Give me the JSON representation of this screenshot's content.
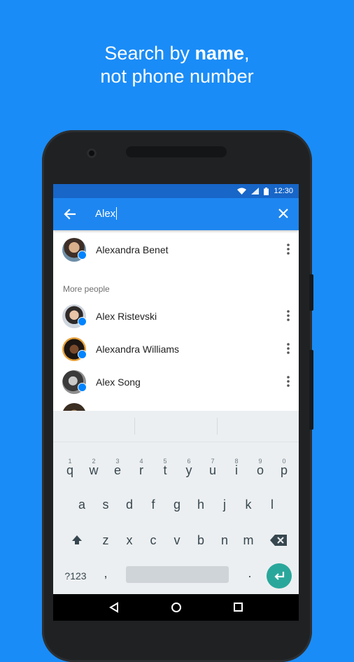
{
  "headline": {
    "line1_prefix": "Search by ",
    "line1_bold": "name",
    "line1_suffix": ",",
    "line2": "not phone number"
  },
  "status_bar": {
    "time": "12:30",
    "icons": [
      "wifi-icon",
      "signal-icon",
      "battery-icon"
    ]
  },
  "search": {
    "query": "Alex",
    "back_icon": "back-arrow-icon",
    "clear_icon": "close-icon"
  },
  "top_result": {
    "name": "Alexandra Benet"
  },
  "more_people": {
    "label": "More people",
    "items": [
      {
        "name": "Alex Ristevski"
      },
      {
        "name": "Alexandra Williams"
      },
      {
        "name": "Alex Song"
      }
    ]
  },
  "keyboard": {
    "row1": [
      "q",
      "w",
      "e",
      "r",
      "t",
      "y",
      "u",
      "i",
      "o",
      "p"
    ],
    "row1_numbers": [
      "1",
      "2",
      "3",
      "4",
      "5",
      "6",
      "7",
      "8",
      "9",
      "0"
    ],
    "row2": [
      "a",
      "s",
      "d",
      "f",
      "g",
      "h",
      "j",
      "k",
      "l"
    ],
    "row3": [
      "z",
      "x",
      "c",
      "v",
      "b",
      "n",
      "m"
    ],
    "symbols_key": "?123",
    "comma_key": ",",
    "period_key": ".",
    "accent_color": "#2aa79b"
  },
  "colors": {
    "background": "#1a8cf7",
    "appbar": "#1e86f0",
    "statusbar": "#1766c8",
    "messenger_badge": "#0084ff"
  }
}
